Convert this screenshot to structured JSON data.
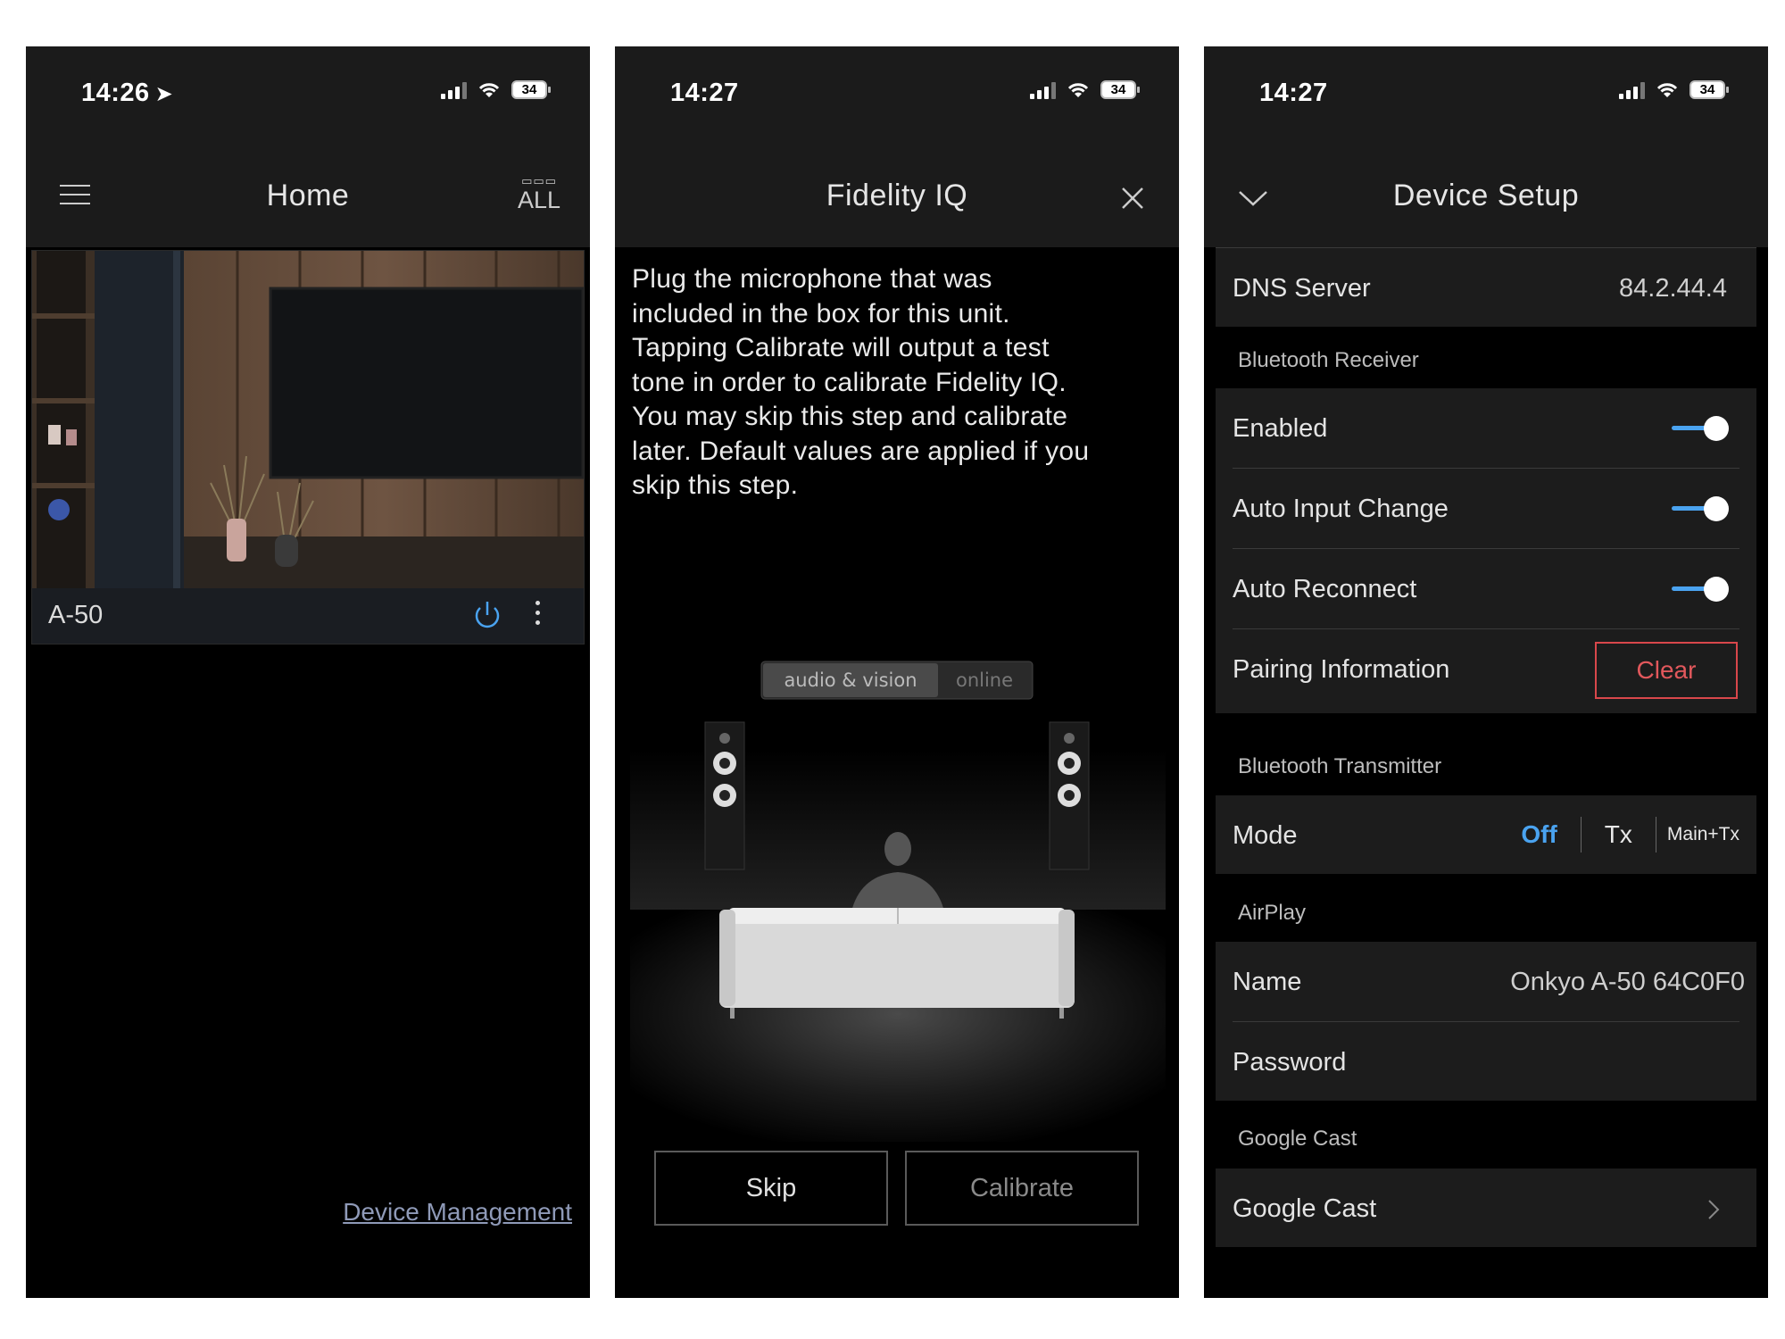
{
  "panels": {
    "home": {
      "status_time": "14:26",
      "battery": "34",
      "title": "Home",
      "all_label": "ALL",
      "device_name": "A-50",
      "device_management": "Device Management"
    },
    "fidelity": {
      "status_time": "14:27",
      "battery": "34",
      "title": "Fidelity IQ",
      "instructions": [
        "Plug the microphone that was",
        "included in the box for this unit.",
        "Tapping Calibrate will output a test",
        "tone in order to calibrate Fidelity IQ.",
        "You may skip this step and calibrate",
        "later. Default values are applied if you",
        "skip this step."
      ],
      "watermark_left": "audio & vision",
      "watermark_right": "online",
      "skip_label": "Skip",
      "calibrate_label": "Calibrate"
    },
    "setup": {
      "status_time": "14:27",
      "battery": "34",
      "title": "Device Setup",
      "dns": {
        "label": "DNS Server",
        "value": "84.2.44.4"
      },
      "bt_receiver": {
        "section": "Bluetooth Receiver",
        "enabled": "Enabled",
        "auto_input": "Auto Input Change",
        "auto_reconnect": "Auto Reconnect",
        "pairing": "Pairing Information",
        "clear": "Clear"
      },
      "bt_transmitter": {
        "section": "Bluetooth Transmitter",
        "mode": "Mode",
        "off": "Off",
        "tx": "Tx",
        "main_tx": "Main+Tx"
      },
      "airplay": {
        "section": "AirPlay",
        "name_label": "Name",
        "name_value": "Onkyo A-50 64C0F0",
        "password": "Password"
      },
      "google_cast": {
        "section": "Google Cast",
        "item": "Google Cast"
      }
    }
  },
  "colors": {
    "accent": "#4aa3f0",
    "clear_red": "#e2585c",
    "header_bg": "#1b1b1b"
  }
}
